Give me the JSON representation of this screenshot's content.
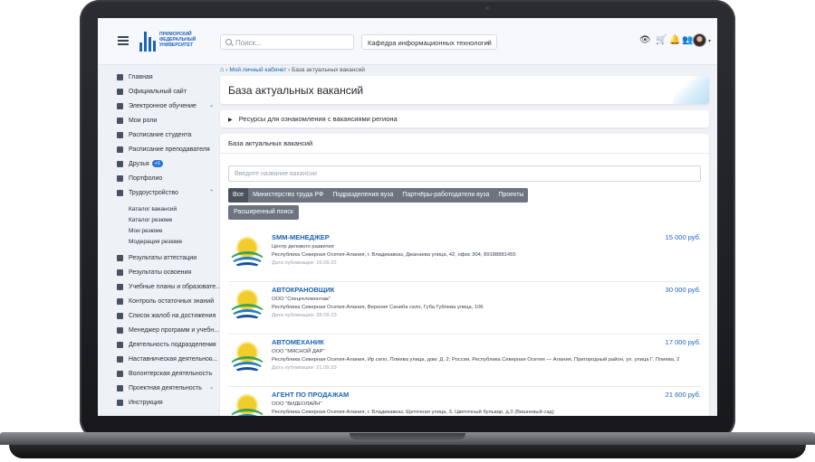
{
  "topbar": {
    "logo_text": "ПРИМОРСКИЙ ФЕДЕРАЛЬНЫЙ УНИВЕРСИТЕТ",
    "search_placeholder": "Поиск...",
    "department": "Кафедра информационных технологий"
  },
  "sidebar": {
    "items": [
      {
        "label": "Главная",
        "icon": "home-icon"
      },
      {
        "label": "Официальный сайт",
        "icon": "globe-icon"
      },
      {
        "label": "Электронное обучение",
        "icon": "graduation-icon",
        "chevron": true
      },
      {
        "label": "Мои роли",
        "icon": "user-icon"
      },
      {
        "label": "Расписание студента",
        "icon": "calendar-icon"
      },
      {
        "label": "Расписание преподавателя",
        "icon": "calendar-icon"
      },
      {
        "label": "Друзья",
        "icon": "users-icon",
        "badge": "+1"
      },
      {
        "label": "Портфолио",
        "icon": "portfolio-icon"
      },
      {
        "label": "Трудоустройство",
        "icon": "briefcase-icon",
        "chevron": true
      }
    ],
    "sub_items": [
      "Каталог вакансий",
      "Каталог резюме",
      "Мои резюме",
      "Модерация резюме"
    ],
    "items_after": [
      {
        "label": "Результаты аттестации",
        "icon": "list-icon"
      },
      {
        "label": "Результаты освоения",
        "icon": "list-icon"
      },
      {
        "label": "Учебные планы и образовате...",
        "icon": "book-icon"
      },
      {
        "label": "Контроль остаточных знаний",
        "icon": "check-icon"
      },
      {
        "label": "Список жалоб на достижения",
        "icon": "warning-icon"
      },
      {
        "label": "Менеджер программ и учебн...",
        "icon": "manager-icon"
      },
      {
        "label": "Деятельность подразделения",
        "icon": "org-icon",
        "chevron": true
      },
      {
        "label": "Наставническая деятельнос...",
        "icon": "mentor-icon",
        "chevron": true
      },
      {
        "label": "Волонтерская деятельность",
        "icon": "heart-icon",
        "chevron": true
      },
      {
        "label": "Проектная деятельность",
        "icon": "project-icon",
        "chevron": true
      },
      {
        "label": "Инструкция",
        "icon": "info-icon"
      }
    ]
  },
  "breadcrumb": {
    "link": "Мой личный кабинет",
    "current": "База актуальных вакансий"
  },
  "page": {
    "title": "База актуальных вакансий",
    "resources": "Ресурсы для ознакомления с вакансиями региона",
    "section_title": "База актуальных вакансий",
    "input_placeholder": "Введите название вакансии",
    "tabs": [
      "Все",
      "Министерство труда РФ",
      "Подразделения вуза",
      "Партнёры-работодатели вуза",
      "Проекты"
    ],
    "advanced_search": "Расширенный поиск"
  },
  "jobs": [
    {
      "title": "SMM-МЕНЕДЖЕР",
      "salary": "15 000 руб.",
      "org": "Центр делового развития",
      "address": "Республика Северная Осетия-Алания, г. Владикавказ, Джанаева улица, 42, офис 304, 89188881455",
      "date": "Дата публикации: 16.09.22"
    },
    {
      "title": "АВТОКРАНОВЩИК",
      "salary": "30 000 руб.",
      "org": "ООО \"Спецгеломонтаж\"",
      "address": "Республика Северная Осетия-Алания, Верхняя Санибa село, Губа Гублева улица, 106",
      "date": "Дата публикации: 28.09.23"
    },
    {
      "title": "АВТОМЕХАНИК",
      "salary": "17 000 руб.",
      "org": "ООО \"МЯСНОЙ ДАР\"",
      "address": "Республика Северная Осетия-Алания, Ир село, Плиева улица, дом: Д. 2; Россия, Республика Северная Осетия — Алания, Пригородный район, ул. улица Г. Плиева, 2",
      "date": "Дата публикации: 21.09.23"
    },
    {
      "title": "АГЕНТ ПО ПРОДАЖАМ",
      "salary": "21 600 руб.",
      "org": "ООО \"ВИДЕОЛАЙН\"",
      "address": "Республика Северная Осетия-Алания, г. Владикавказ, Щеточная улица, 3, Цветочный бульвар, д.3 (Вишневый сад)",
      "date": ""
    }
  ]
}
